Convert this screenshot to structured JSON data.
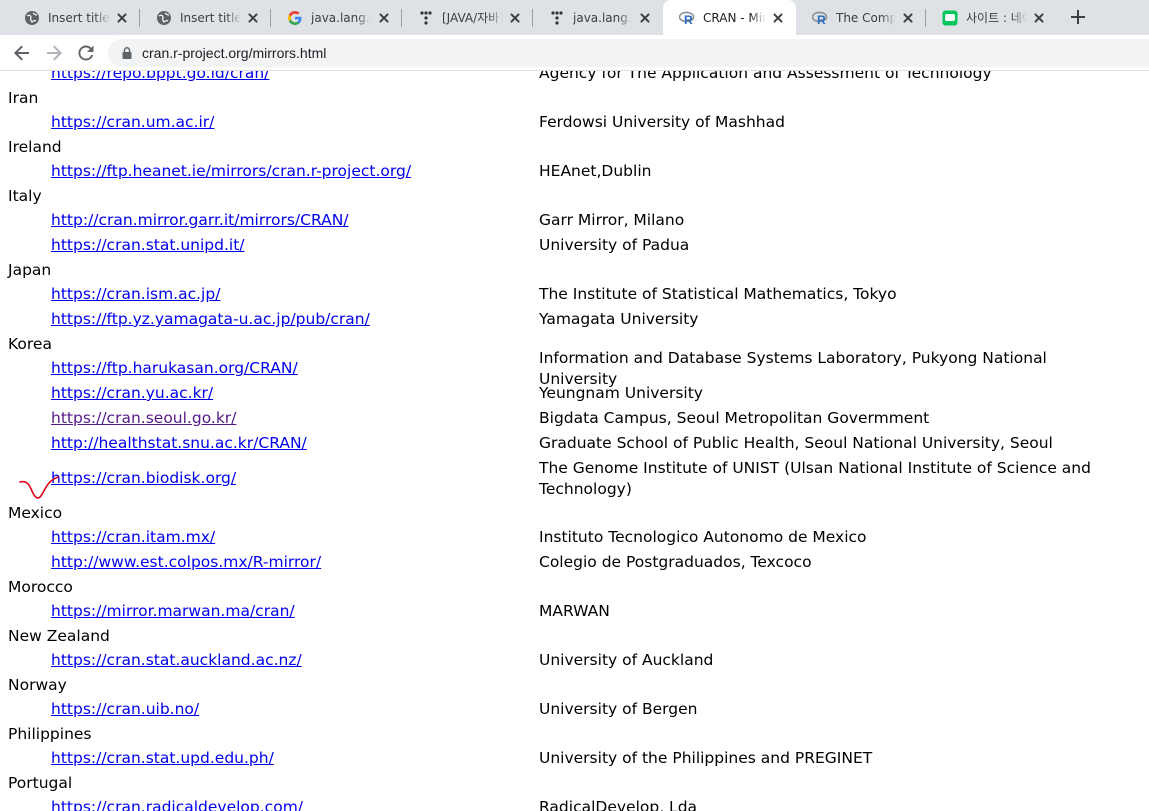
{
  "browser": {
    "tabs": [
      {
        "title": "Insert title here",
        "icon": "globe-icon",
        "active": false
      },
      {
        "title": "Insert title here",
        "icon": "globe-icon",
        "active": false
      },
      {
        "title": "java.lang.ClassNotFound",
        "icon": "google-icon",
        "active": false
      },
      {
        "title": "[JAVA/자바] java.lang",
        "icon": "velog-icon",
        "active": false
      },
      {
        "title": "java.lang.ClassNotFound",
        "icon": "velog-icon",
        "active": false
      },
      {
        "title": "CRAN - Mirrors",
        "icon": "r-logo-icon",
        "active": true
      },
      {
        "title": "The Comprehensive R",
        "icon": "r-logo-icon",
        "active": false
      },
      {
        "title": "사이트 : 네이버 블로그",
        "icon": "naver-blog-icon",
        "active": false
      }
    ],
    "address": "cran.r-project.org/mirrors.html"
  },
  "mirrors": [
    {
      "url": "https://repo.bppt.go.id/cran/",
      "host": "Agency for The Application and Assessment of Technology"
    },
    {
      "country": "Iran"
    },
    {
      "url": "https://cran.um.ac.ir/",
      "host": "Ferdowsi University of Mashhad"
    },
    {
      "country": "Ireland"
    },
    {
      "url": "https://ftp.heanet.ie/mirrors/cran.r-project.org/",
      "host": "HEAnet,Dublin"
    },
    {
      "country": "Italy"
    },
    {
      "url": "http://cran.mirror.garr.it/mirrors/CRAN/",
      "host": "Garr Mirror, Milano"
    },
    {
      "url": "https://cran.stat.unipd.it/",
      "host": "University of Padua"
    },
    {
      "country": "Japan"
    },
    {
      "url": "https://cran.ism.ac.jp/",
      "host": "The Institute of Statistical Mathematics, Tokyo"
    },
    {
      "url": "https://ftp.yz.yamagata-u.ac.jp/pub/cran/",
      "host": "Yamagata University"
    },
    {
      "country": "Korea"
    },
    {
      "url": "https://ftp.harukasan.org/CRAN/",
      "host": "Information and Database Systems Laboratory, Pukyong National University"
    },
    {
      "url": "https://cran.yu.ac.kr/",
      "host": "Yeungnam University"
    },
    {
      "url": "https://cran.seoul.go.kr/",
      "host": "Bigdata Campus, Seoul Metropolitan Govermment",
      "visited": true
    },
    {
      "url": "http://healthstat.snu.ac.kr/CRAN/",
      "host": "Graduate School of Public Health, Seoul National University, Seoul"
    },
    {
      "url": "https://cran.biodisk.org/",
      "host": "The Genome Institute of UNIST (Ulsan National Institute of Science and Technology)",
      "tall": true
    },
    {
      "country": "Mexico"
    },
    {
      "url": "https://cran.itam.mx/",
      "host": "Instituto Tecnologico Autonomo de Mexico"
    },
    {
      "url": "http://www.est.colpos.mx/R-mirror/",
      "host": "Colegio de Postgraduados, Texcoco"
    },
    {
      "country": "Morocco"
    },
    {
      "url": "https://mirror.marwan.ma/cran/",
      "host": "MARWAN"
    },
    {
      "country": "New Zealand"
    },
    {
      "url": "https://cran.stat.auckland.ac.nz/",
      "host": "University of Auckland"
    },
    {
      "country": "Norway"
    },
    {
      "url": "https://cran.uib.no/",
      "host": "University of Bergen"
    },
    {
      "country": "Philippines"
    },
    {
      "url": "https://cran.stat.upd.edu.ph/",
      "host": "University of the Philippines and PREGINET"
    },
    {
      "country": "Portugal"
    },
    {
      "url": "https://cran.radicaldevelop.com/",
      "host": "RadicalDevelop, Lda"
    }
  ],
  "colors": {
    "link": "#0000ee",
    "visited_link": "#551a8b",
    "annotation": "#e0001a"
  }
}
